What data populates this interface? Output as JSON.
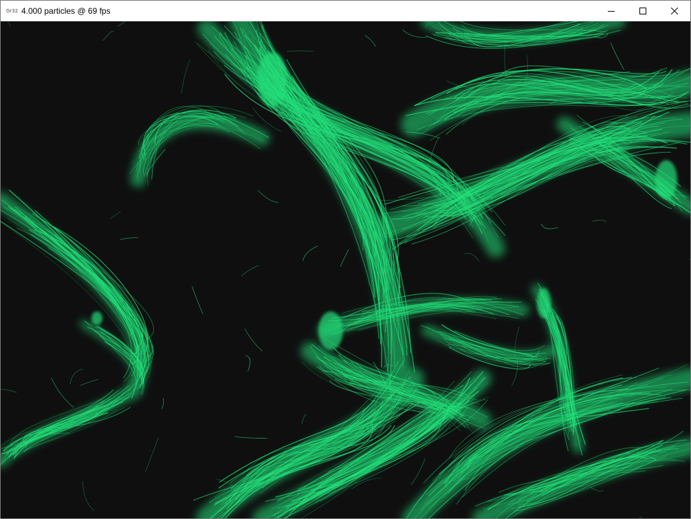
{
  "window": {
    "app_icon_label": "Gr32",
    "title": "4.000 particles @ 69 fps",
    "controls": {
      "minimize_icon": "minimize-icon",
      "maximize_icon": "maximize-icon",
      "close_icon": "close-icon"
    }
  },
  "canvas": {
    "background_color": "#0f0f0f",
    "particle_color": "#22e07a",
    "content": "particle-flow-visualization"
  }
}
